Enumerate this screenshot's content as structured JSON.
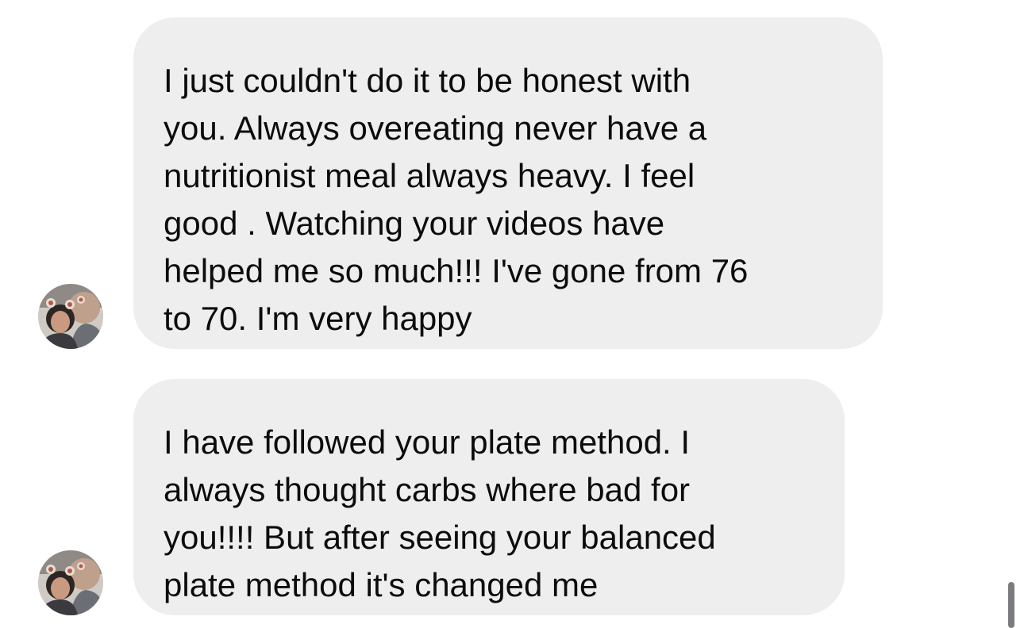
{
  "conversation": {
    "messages": [
      {
        "lines": [
          "I just couldn't do it to be honest with",
          "you. Always overeating never have a",
          "nutritionist meal always heavy. I feel",
          "good . Watching your videos have",
          "helped me so much!!! I've gone from 76",
          "to 70. I'm very happy"
        ],
        "avatar_icon": "profile-photo-icon"
      },
      {
        "lines": [
          "I have followed your plate method. I",
          "always thought carbs where bad for",
          "you!!!! But after seeing your balanced",
          "plate method it's changed me"
        ],
        "avatar_icon": "profile-photo-icon"
      }
    ]
  },
  "colors": {
    "bubble_background": "#eeeeef",
    "text": "#0c0c0c",
    "page_background": "#ffffff",
    "scrollbar": "#7c7c80"
  }
}
